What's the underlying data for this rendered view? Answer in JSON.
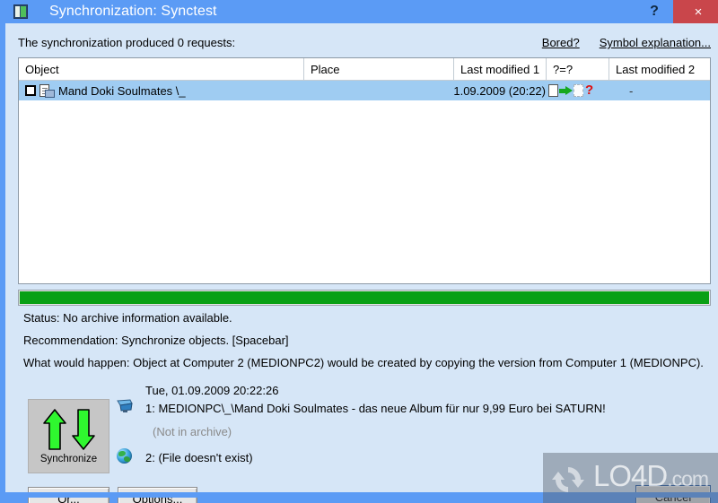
{
  "window": {
    "title": "Synchronization: Synctest",
    "app_icon": "app-window-icon",
    "help_label": "?",
    "close_label": "×",
    "titlebar_color": "#5b9bf5",
    "close_color": "#c9464b",
    "body_color": "#d6e6f7"
  },
  "header": {
    "summary": "The synchronization produced 0 requests:",
    "links": [
      {
        "label": "Bored?",
        "name": "bored-link"
      },
      {
        "label": "Symbol explanation...",
        "name": "symbol-explanation-link"
      }
    ]
  },
  "table": {
    "columns": [
      {
        "label": "Object"
      },
      {
        "label": "Place"
      },
      {
        "label": "Last modified 1"
      },
      {
        "label": "?=?"
      },
      {
        "label": "Last modified 2"
      }
    ],
    "rows": [
      {
        "checked": false,
        "object": "Mand Doki Soulmates \\_",
        "place": "",
        "last_modified_1": "01.09.2009 (20:22)",
        "symbols": [
          "document",
          "green-arrow-right",
          "document-missing",
          "red-question"
        ],
        "last_modified_2": "-"
      }
    ]
  },
  "progress": {
    "percent": 100,
    "color": "#09a015"
  },
  "info": {
    "status": "Status: No archive information available.",
    "recommendation": "Recommendation: Synchronize objects. [Spacebar]",
    "what_would_happen": "What would happen: Object at Computer 2 (MEDIONPC2) would be created by copying the version from Computer 1 (MEDIONPC)."
  },
  "detail": {
    "timestamp": "Tue, 01.09.2009 20:22:26",
    "line1": "1: MEDIONPC\\_\\Mand Doki Soulmates - das neue Album für nur 9,99 Euro bei SATURN!",
    "line1_note": "(Not in archive)",
    "line2": "2: (File doesn't exist)",
    "sync_button_label": "Synchronize",
    "arrow_color": "#2ff72f"
  },
  "buttons": {
    "or": "Or...",
    "options": "Options...",
    "cancel": "Cancel"
  },
  "watermark": {
    "text": "LO4D",
    "suffix": ".com"
  }
}
